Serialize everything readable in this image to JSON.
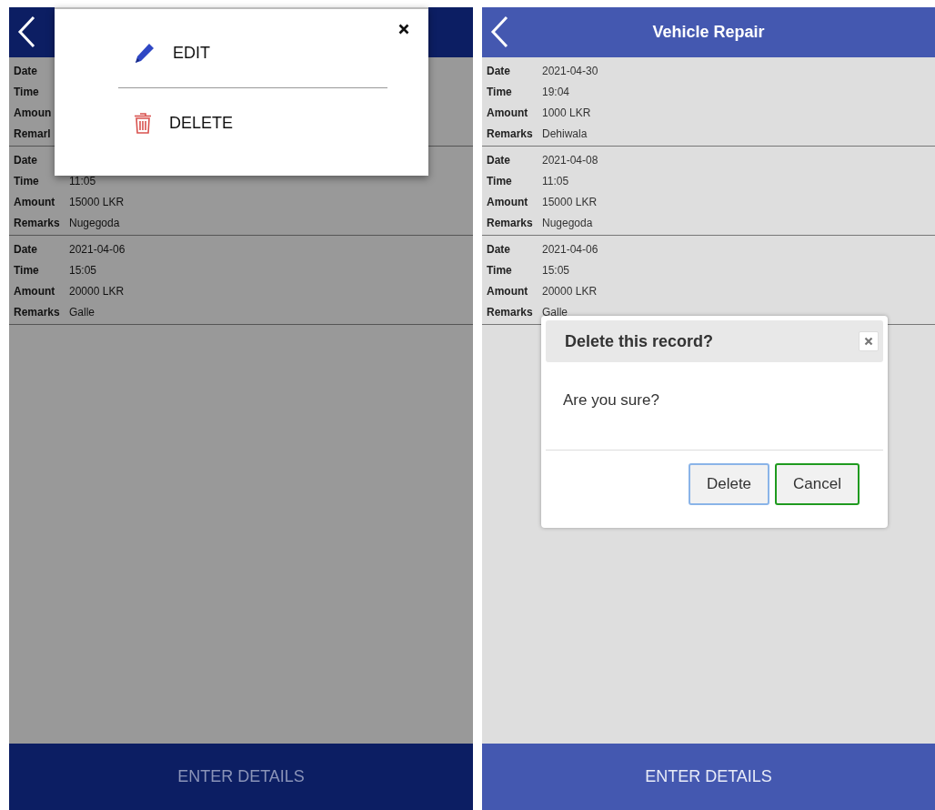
{
  "screens": [
    {
      "dimmed": true,
      "records": [
        {
          "fields": [
            {
              "label": "Date"
            },
            {
              "label": "Time"
            },
            {
              "label": "Amoun"
            },
            {
              "label": "Remarl"
            }
          ]
        },
        {
          "fields": [
            {
              "label": "Date"
            },
            {
              "label": "Time",
              "value": "11:05"
            },
            {
              "label": "Amount",
              "value": "15000 LKR"
            },
            {
              "label": "Remarks",
              "value": "Nugegoda"
            }
          ]
        },
        {
          "fields": [
            {
              "label": "Date",
              "value": "2021-04-06"
            },
            {
              "label": "Time",
              "value": "15:05"
            },
            {
              "label": "Amount",
              "value": "20000 LKR"
            },
            {
              "label": "Remarks",
              "value": "Galle"
            }
          ]
        }
      ],
      "menu": {
        "items": [
          {
            "kind": "edit",
            "label": "EDIT"
          },
          {
            "kind": "delete",
            "label": "DELETE"
          }
        ]
      },
      "footer": "ENTER DETAILS"
    },
    {
      "dimmed": false,
      "title": "Vehicle Repair",
      "records": [
        {
          "fields": [
            {
              "label": "Date",
              "value": "2021-04-30"
            },
            {
              "label": "Time",
              "value": "19:04"
            },
            {
              "label": "Amount",
              "value": "1000 LKR"
            },
            {
              "label": "Remarks",
              "value": "Dehiwala"
            }
          ]
        },
        {
          "fields": [
            {
              "label": "Date",
              "value": "2021-04-08"
            },
            {
              "label": "Time",
              "value": "11:05"
            },
            {
              "label": "Amount",
              "value": "15000 LKR"
            },
            {
              "label": "Remarks",
              "value": "Nugegoda"
            }
          ]
        },
        {
          "fields": [
            {
              "label": "Date",
              "value": "2021-04-06"
            },
            {
              "label": "Time",
              "value": "15:05"
            },
            {
              "label": "Amount",
              "value": "20000 LKR"
            },
            {
              "label": "Remarks",
              "value": "Galle"
            }
          ]
        }
      ],
      "dialog": {
        "title": "Delete this record?",
        "message": "Are you sure?",
        "buttons": [
          {
            "label": "Delete",
            "color": "#8ab4e8"
          },
          {
            "label": "Cancel",
            "color": "#1f9a1f"
          }
        ]
      },
      "footer": "ENTER DETAILS"
    }
  ]
}
